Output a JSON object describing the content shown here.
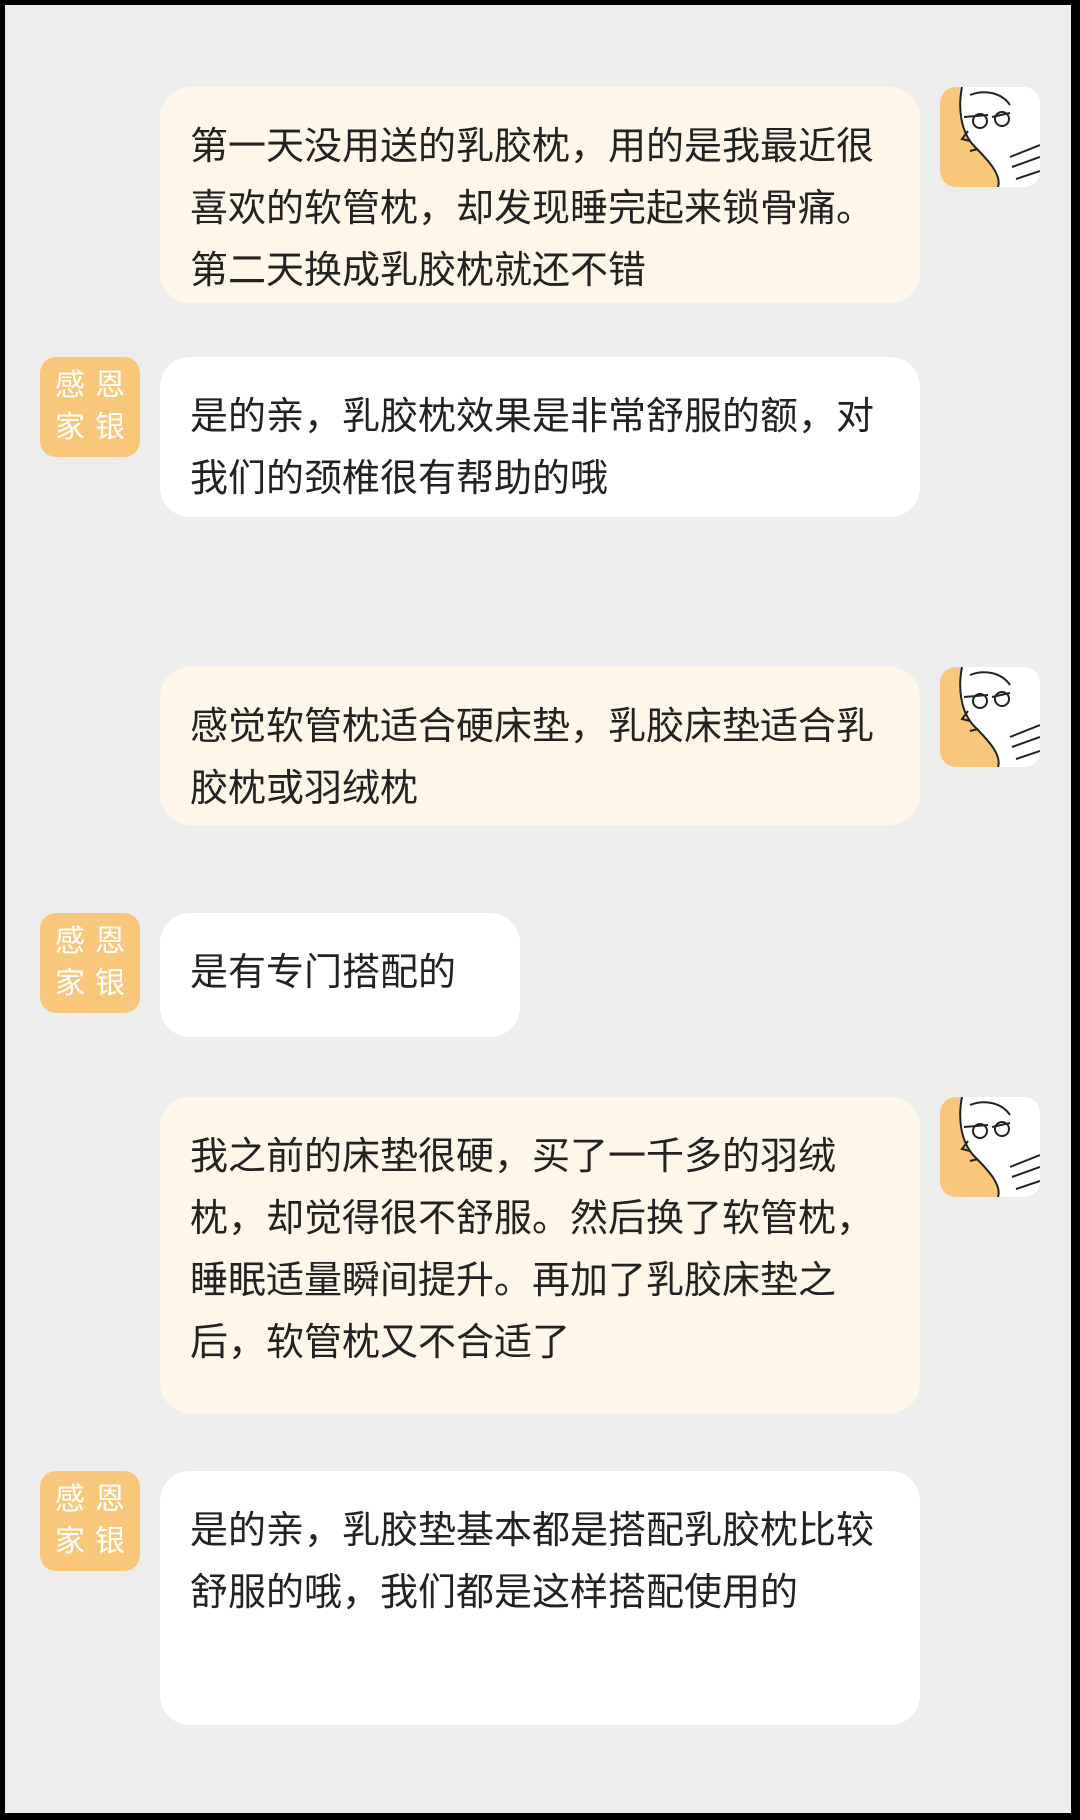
{
  "shop_avatar": {
    "chars": [
      "感",
      "恩",
      "家",
      "银"
    ]
  },
  "messages": [
    {
      "sender": "user",
      "text": "第一天没用送的乳胶枕，用的是我最近很喜欢的软管枕，却发现睡完起来锁骨痛。第二天换成乳胶枕就还不错"
    },
    {
      "sender": "agent",
      "text": "是的亲，乳胶枕效果是非常舒服的额，对我们的颈椎很有帮助的哦"
    },
    {
      "sender": "user",
      "text": "感觉软管枕适合硬床垫，乳胶床垫适合乳胶枕或羽绒枕"
    },
    {
      "sender": "agent",
      "text": "是有专门搭配的"
    },
    {
      "sender": "user",
      "text": "我之前的床垫很硬，买了一千多的羽绒枕，却觉得很不舒服。然后换了软管枕，睡眠适量瞬间提升。再加了乳胶床垫之后，软管枕又不合适了"
    },
    {
      "sender": "agent",
      "text": "是的亲，乳胶垫基本都是搭配乳胶枕比较舒服的哦，我们都是这样搭配使用的"
    }
  ],
  "colors": {
    "background": "#ededed",
    "user_bubble": "#fdf6e9",
    "agent_bubble": "#ffffff",
    "agent_avatar": "#f9c77b"
  }
}
